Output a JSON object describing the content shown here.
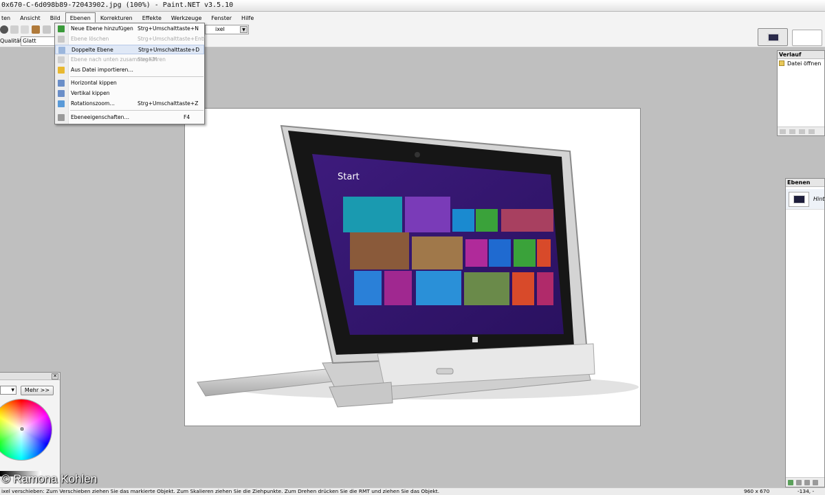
{
  "window": {
    "title": "0x670-C-6d098b89-72043902.jpg (100%) - Paint.NET v3.5.10"
  },
  "menubar": {
    "items": [
      "ten",
      "Ansicht",
      "Bild",
      "Ebenen",
      "Korrekturen",
      "Effekte",
      "Werkzeuge",
      "Fenster",
      "Hilfe"
    ],
    "active": "Ebenen"
  },
  "toolbar": {
    "quality_label": "Qualität:",
    "quality_value": "Glatt",
    "pixel_value": "ixel"
  },
  "ebenen_menu": {
    "items": [
      {
        "label": "Neue Ebene hinzufügen",
        "shortcut": "Strg+Umschalttaste+N",
        "enabled": true,
        "icon": "add-layer-icon",
        "color": "#3a9a3a"
      },
      {
        "label": "Ebene löschen",
        "shortcut": "Strg+Umschalttaste+Entf",
        "enabled": false,
        "icon": "delete-layer-icon",
        "color": "#c8c8c8"
      },
      {
        "label": "Doppelte Ebene",
        "shortcut": "Strg+Umschalttaste+D",
        "enabled": true,
        "icon": "duplicate-layer-icon",
        "color": "#9bb6dc",
        "highlighted": true
      },
      {
        "label": "Ebene nach unten zusammenführen",
        "shortcut": "Strg+M",
        "enabled": false,
        "icon": "merge-down-icon",
        "color": "#cfcfcf"
      },
      {
        "label": "Aus Datei importieren…",
        "shortcut": "",
        "enabled": true,
        "icon": "import-file-icon",
        "color": "#e8b830"
      },
      {
        "label": "Horizontal kippen",
        "shortcut": "",
        "enabled": true,
        "icon": "flip-horizontal-icon",
        "color": "#6a8ec8"
      },
      {
        "label": "Vertikal kippen",
        "shortcut": "",
        "enabled": true,
        "icon": "flip-vertical-icon",
        "color": "#6a8ec8"
      },
      {
        "label": "Rotationszoom…",
        "shortcut": "Strg+Umschalttaste+Z",
        "enabled": true,
        "icon": "rotate-zoom-icon",
        "color": "#5a9ad8"
      },
      {
        "label": "Ebeneeigenschaften…",
        "shortcut": "F4",
        "enabled": true,
        "icon": "layer-properties-icon",
        "color": "#9a9a9a"
      }
    ]
  },
  "history_panel": {
    "title": "Verlauf",
    "items": [
      "Datei öffnen"
    ]
  },
  "layers_panel": {
    "title": "Ebenen",
    "layer_name": "Hinte"
  },
  "colors_panel": {
    "more_label": "Mehr >>"
  },
  "watermark": "© Ramona Kohlen",
  "statusbar": {
    "hint": "ixel verschieben: Zum Verschieben ziehen Sie das markierte Objekt. Zum Skalieren ziehen Sie die Ziehpunkte. Zum Drehen drücken Sie die RMT und ziehen Sie das Objekt.",
    "image_size": "960 x 670",
    "coords": "-134, -"
  },
  "theme": {
    "accent": "#dfe8f6",
    "start_screen": "#3b1a78"
  }
}
